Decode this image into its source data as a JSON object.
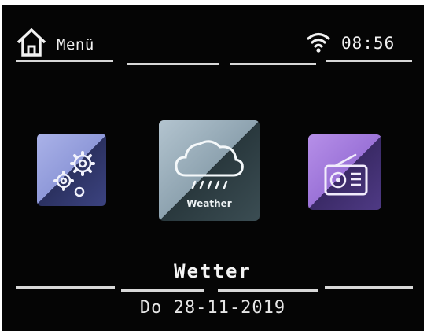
{
  "statusbar": {
    "menu_label": "Menü",
    "time": "08:56",
    "home_icon": "home-icon",
    "wifi_icon": "wifi-icon"
  },
  "tiles": [
    {
      "icon": "gears-icon",
      "caption": ""
    },
    {
      "icon": "weather-cloud-rain-icon",
      "caption": "Weather"
    },
    {
      "icon": "radio-icon",
      "caption": ""
    }
  ],
  "selected": {
    "title": "Wetter"
  },
  "footer": {
    "date": "Do 28-11-2019"
  },
  "colors": {
    "background": "#050505",
    "text": "#f2f2f2",
    "settings_tile": "#9aa3df",
    "weather_tile": "#9fb2be",
    "radio_tile": "#a884e0"
  }
}
